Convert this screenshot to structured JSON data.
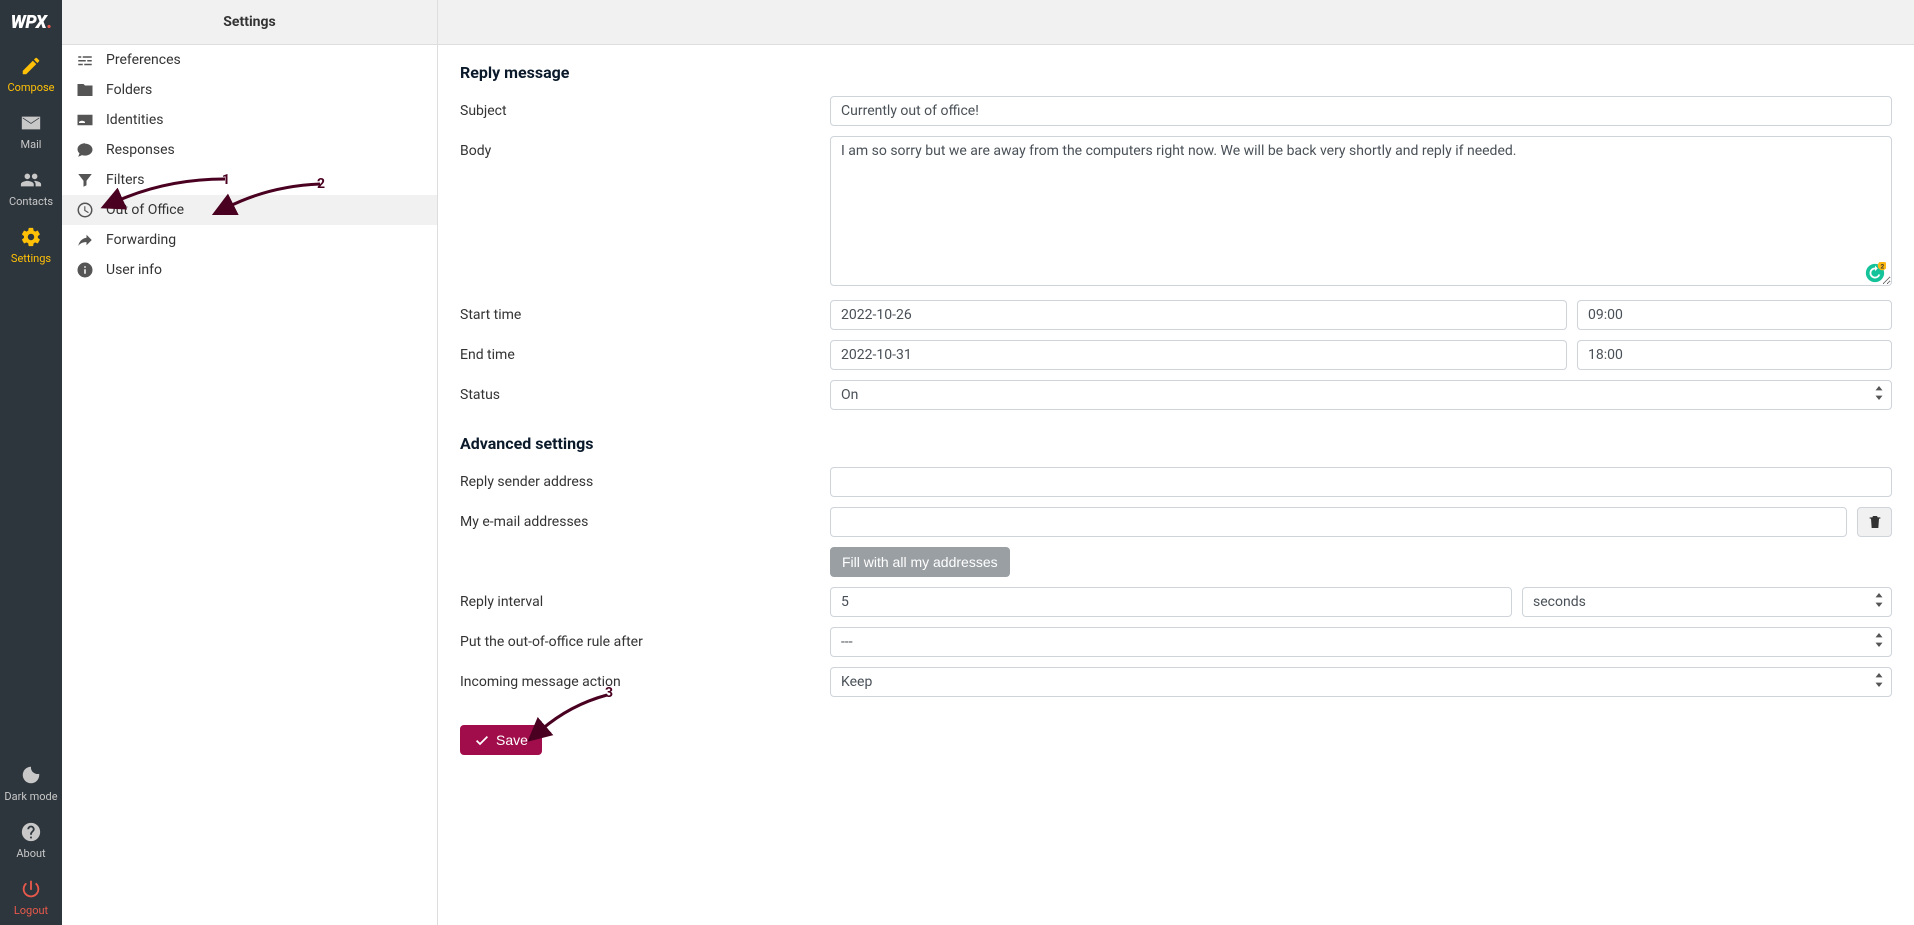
{
  "nav": {
    "logo_main": "WPX",
    "logo_dot": ".",
    "items_top": [
      {
        "name": "compose",
        "label": "Compose",
        "icon": "compose-icon"
      },
      {
        "name": "mail",
        "label": "Mail",
        "icon": "envelope-icon"
      },
      {
        "name": "contacts",
        "label": "Contacts",
        "icon": "people-icon"
      },
      {
        "name": "settings",
        "label": "Settings",
        "icon": "gear-icon"
      }
    ],
    "items_bottom": [
      {
        "name": "darkmode",
        "label": "Dark mode",
        "icon": "moon-icon"
      },
      {
        "name": "about",
        "label": "About",
        "icon": "question-icon"
      },
      {
        "name": "logout",
        "label": "Logout",
        "icon": "power-icon"
      }
    ]
  },
  "settings": {
    "title": "Settings",
    "items": [
      {
        "icon": "sliders-icon",
        "label": "Preferences"
      },
      {
        "icon": "folder-icon",
        "label": "Folders"
      },
      {
        "icon": "idcard-icon",
        "label": "Identities"
      },
      {
        "icon": "chat-icon",
        "label": "Responses"
      },
      {
        "icon": "funnel-icon",
        "label": "Filters"
      },
      {
        "icon": "clock-icon",
        "label": "Out of Office"
      },
      {
        "icon": "share-icon",
        "label": "Forwarding"
      },
      {
        "icon": "info-icon",
        "label": "User info"
      }
    ],
    "selected_index": 5
  },
  "form": {
    "reply_heading": "Reply message",
    "advanced_heading": "Advanced settings",
    "labels": {
      "subject": "Subject",
      "body": "Body",
      "start_time": "Start time",
      "end_time": "End time",
      "status": "Status",
      "reply_sender": "Reply sender address",
      "my_emails": "My e-mail addresses",
      "fill_all": "Fill with all my addresses",
      "reply_interval": "Reply interval",
      "rule_after": "Put the out-of-office rule after",
      "incoming_action": "Incoming message action",
      "save": "Save"
    },
    "values": {
      "subject": "Currently out of office!",
      "body": "I am so sorry but we are away from the computers right now. We will be back very shortly and reply if needed.",
      "start_date": "2022-10-26",
      "start_time": "09:00",
      "end_date": "2022-10-31",
      "end_time": "18:00",
      "status": "On",
      "reply_sender": "",
      "my_emails": "",
      "reply_interval": "5",
      "interval_unit": "seconds",
      "rule_after": "---",
      "incoming_action": "Keep"
    }
  },
  "grammarly_badge_count": "2",
  "annotations": {
    "a1": "1",
    "a2": "2",
    "a3": "3"
  }
}
